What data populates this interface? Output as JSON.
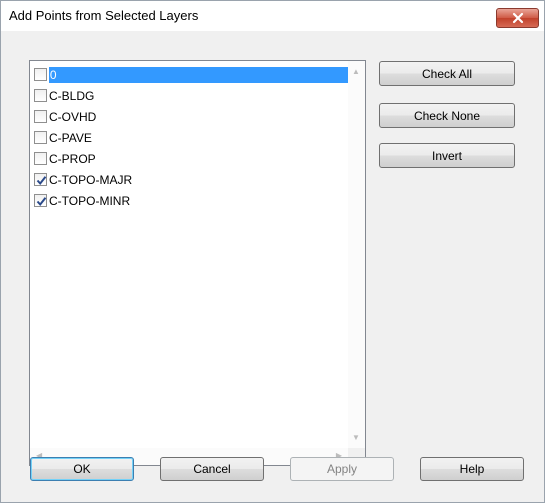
{
  "dialog": {
    "title": "Add Points from Selected Layers"
  },
  "layers": [
    {
      "name": "0",
      "checked": false,
      "selected": true
    },
    {
      "name": "C-BLDG",
      "checked": false,
      "selected": false
    },
    {
      "name": "C-OVHD",
      "checked": false,
      "selected": false
    },
    {
      "name": "C-PAVE",
      "checked": false,
      "selected": false
    },
    {
      "name": "C-PROP",
      "checked": false,
      "selected": false
    },
    {
      "name": "C-TOPO-MAJR",
      "checked": true,
      "selected": false
    },
    {
      "name": "C-TOPO-MINR",
      "checked": true,
      "selected": false
    }
  ],
  "side_buttons": {
    "check_all": "Check All",
    "check_none": "Check None",
    "invert": "Invert"
  },
  "footer_buttons": {
    "ok": "OK",
    "cancel": "Cancel",
    "apply": "Apply",
    "help": "Help"
  },
  "colors": {
    "selection": "#3399ff",
    "close_button": "#c1412b",
    "checkmark": "#2b4a8a"
  }
}
